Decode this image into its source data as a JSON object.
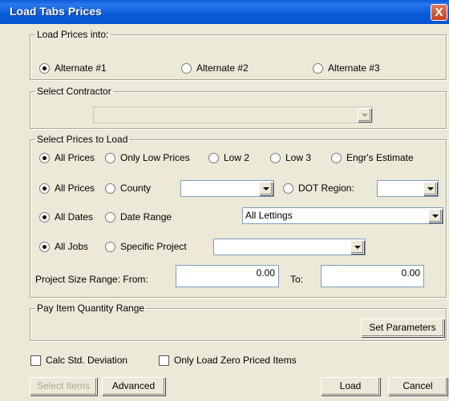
{
  "window": {
    "title": "Load Tabs Prices",
    "close_glyph": "X"
  },
  "load_into": {
    "legend": "Load Prices into:",
    "options": [
      {
        "label": "Alternate #1",
        "checked": true
      },
      {
        "label": "Alternate #2",
        "checked": false
      },
      {
        "label": "Alternate #3",
        "checked": false
      }
    ]
  },
  "contractor": {
    "legend": "Select Contractor",
    "value": ""
  },
  "prices": {
    "legend": "Select Prices to Load",
    "price_type": [
      {
        "label": "All Prices",
        "checked": true
      },
      {
        "label": "Only Low Prices",
        "checked": false
      },
      {
        "label": "Low 2",
        "checked": false
      },
      {
        "label": "Low 3",
        "checked": false
      },
      {
        "label": "Engr's Estimate",
        "checked": false
      }
    ],
    "location": {
      "all_label": "All Prices",
      "county_label": "County",
      "county_value": "",
      "dot_label": "DOT Region:",
      "dot_value": ""
    },
    "dates": {
      "all_label": "All Dates",
      "range_label": "Date Range",
      "selected": "All Lettings"
    },
    "jobs": {
      "all_label": "All Jobs",
      "specific_label": "Specific Project",
      "project_value": ""
    },
    "size_range": {
      "label": "Project Size Range:  From:",
      "from": "0.00",
      "to_label": "To:",
      "to": "0.00"
    }
  },
  "pay_item": {
    "legend": "Pay Item Quantity Range",
    "set_params_label": "Set Parameters"
  },
  "checks": {
    "calc_std": {
      "label": "Calc Std. Deviation",
      "checked": false
    },
    "zero_priced": {
      "label": "Only Load Zero Priced Items",
      "checked": false
    }
  },
  "buttons": {
    "select_items": "Select Items",
    "advanced": "Advanced",
    "load": "Load",
    "cancel": "Cancel"
  }
}
